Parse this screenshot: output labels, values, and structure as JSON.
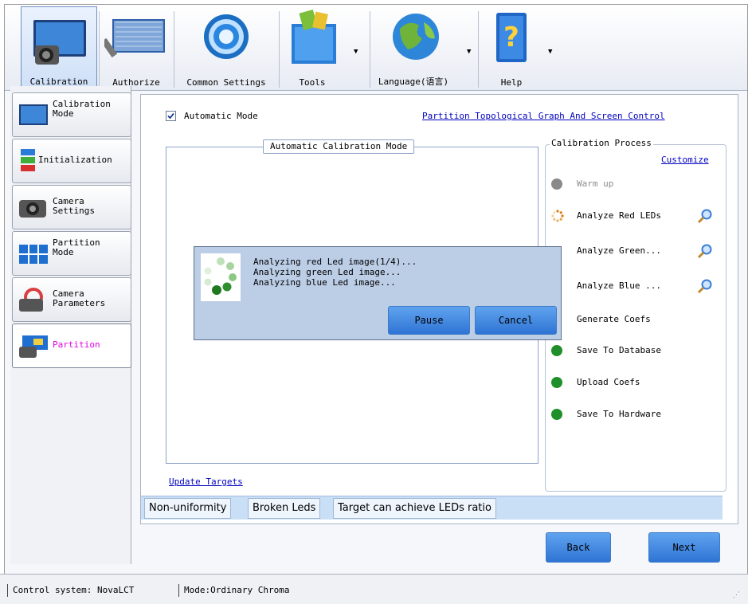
{
  "toolbar": {
    "items": [
      {
        "label": "Calibration",
        "icon": "camera-monitor-icon",
        "active": true
      },
      {
        "label": "Authorize",
        "icon": "authorize-panel-icon",
        "active": false
      },
      {
        "label": "Common Settings",
        "icon": "gear-ring-icon",
        "active": false
      },
      {
        "label": "Tools",
        "icon": "tools-box-icon",
        "active": false,
        "dropdown": true
      },
      {
        "label": "Language(语言)",
        "icon": "globe-icon",
        "active": false,
        "dropdown": true
      },
      {
        "label": "Help",
        "icon": "help-book-icon",
        "active": false,
        "dropdown": true
      }
    ]
  },
  "sidebar": {
    "items": [
      {
        "label": "Calibration\nMode",
        "icon": "monitor-icon"
      },
      {
        "label": "Initialization",
        "icon": "battery-stack-icon"
      },
      {
        "label": "Camera\nSettings",
        "icon": "camera-icon"
      },
      {
        "label": "Partition\nMode",
        "icon": "grid-partition-icon"
      },
      {
        "label": "Camera\nParameters",
        "icon": "camera-aperture-icon"
      },
      {
        "label": "Partition",
        "icon": "camera-partition-icon",
        "selected": true
      }
    ]
  },
  "main": {
    "automatic_mode_label": "Automatic Mode",
    "automatic_mode_checked": true,
    "topology_link": "Partition Topological Graph And Screen Control",
    "group_title": "Automatic Calibration Mode",
    "update_targets_link": "Update Targets"
  },
  "process": {
    "title": "Calibration Process",
    "customize_link": "Customize",
    "steps": [
      {
        "label": "Warm up",
        "state": "disabled"
      },
      {
        "label": "Analyze Red LEDs",
        "state": "running"
      },
      {
        "label": "Analyze Green...",
        "state": "pending"
      },
      {
        "label": "Analyze Blue ...",
        "state": "pending"
      },
      {
        "label": "Generate Coefs",
        "state": "pending"
      },
      {
        "label": "Save To Database",
        "state": "pending"
      },
      {
        "label": "Upload Coefs",
        "state": "pending"
      },
      {
        "label": "Save To Hardware",
        "state": "pending"
      }
    ]
  },
  "tabs": [
    "Non-uniformity",
    "Broken Leds",
    "Target can achieve LEDs ratio"
  ],
  "dialog": {
    "lines": "Analyzing red Led image(1/4)...\nAnalyzing green Led image...\nAnalyzing blue Led image...",
    "pause_label": "Pause",
    "cancel_label": "Cancel"
  },
  "footer": {
    "back_label": "Back",
    "next_label": "Next"
  },
  "status": {
    "control_system": "Control system: NovaLCT",
    "mode": "Mode:Ordinary Chroma"
  },
  "colors": {
    "accent_blue": "#2f74d4",
    "link": "#0000c0",
    "selected_text": "#e000e0",
    "step_green": "#1f8f2a",
    "step_orange": "#e07a10"
  }
}
